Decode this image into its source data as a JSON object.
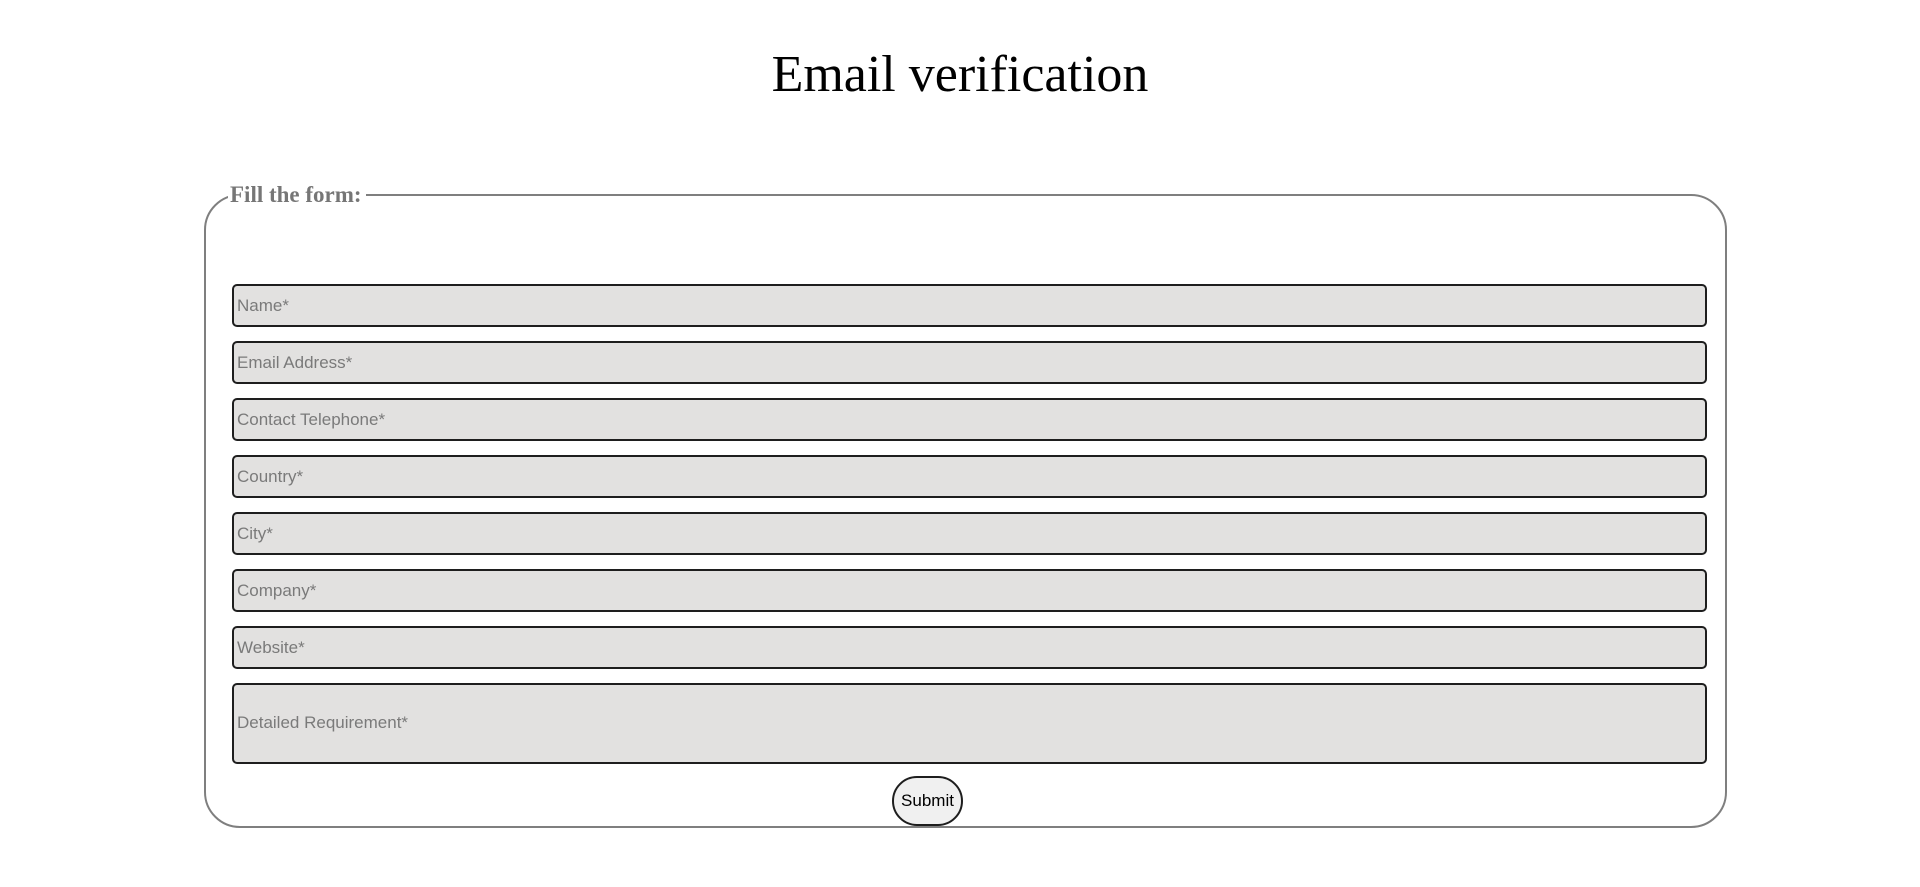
{
  "page": {
    "title": "Email verification"
  },
  "form": {
    "legend": "Fill the form:",
    "fields": {
      "name": {
        "placeholder": "Name*",
        "value": ""
      },
      "email": {
        "placeholder": "Email Address*",
        "value": ""
      },
      "telephone": {
        "placeholder": "Contact Telephone*",
        "value": ""
      },
      "country": {
        "placeholder": "Country*",
        "value": ""
      },
      "city": {
        "placeholder": "City*",
        "value": ""
      },
      "company": {
        "placeholder": "Company*",
        "value": ""
      },
      "website": {
        "placeholder": "Website*",
        "value": ""
      },
      "requirement": {
        "placeholder": "Detailed Requirement*",
        "value": ""
      }
    },
    "submit_label": "Submit"
  },
  "colors": {
    "field_background": "#e2e1e0",
    "field_border": "#1e1e1e",
    "fieldset_border": "#7f7f7f",
    "legend_text": "#767676",
    "placeholder_text": "#7a7a7a"
  }
}
